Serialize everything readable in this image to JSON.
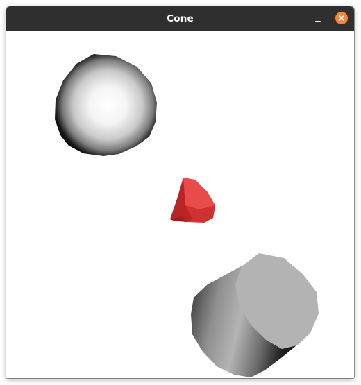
{
  "window": {
    "title": "Cone"
  },
  "titlebar": {
    "minimize_icon": "minimize-icon",
    "close_icon": "close-icon",
    "close_color": "#f0883a",
    "background": "#2f2f2f"
  },
  "scene": {
    "background": "#ffffff",
    "objects": [
      {
        "name": "sphere",
        "color": "#ffffff"
      },
      {
        "name": "cone",
        "color": "#e03a3a"
      },
      {
        "name": "cylinder",
        "color": "#b3b3b3"
      }
    ]
  }
}
